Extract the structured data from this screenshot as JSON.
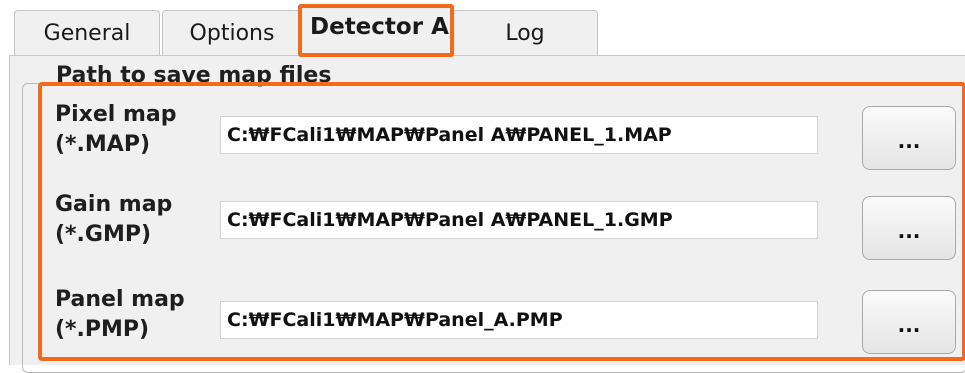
{
  "tabs": {
    "general": "General",
    "options": "Options",
    "detector": "Detector A",
    "log": "Log"
  },
  "group": {
    "title": "Path to save map files"
  },
  "rows": [
    {
      "label": "Pixel map\n(*.MAP)",
      "path": "C:₩FCali1₩MAP₩Panel A₩PANEL_1.MAP",
      "button": "..."
    },
    {
      "label": "Gain map\n(*.GMP)",
      "path": "C:₩FCali1₩MAP₩Panel A₩PANEL_1.GMP",
      "button": "..."
    },
    {
      "label": "Panel map\n(*.PMP)",
      "path": "C:₩FCali1₩MAP₩Panel_A.PMP",
      "button": "..."
    }
  ],
  "colors": {
    "highlight": "#f26a1c",
    "panel_bg": "#f0f0f0"
  }
}
